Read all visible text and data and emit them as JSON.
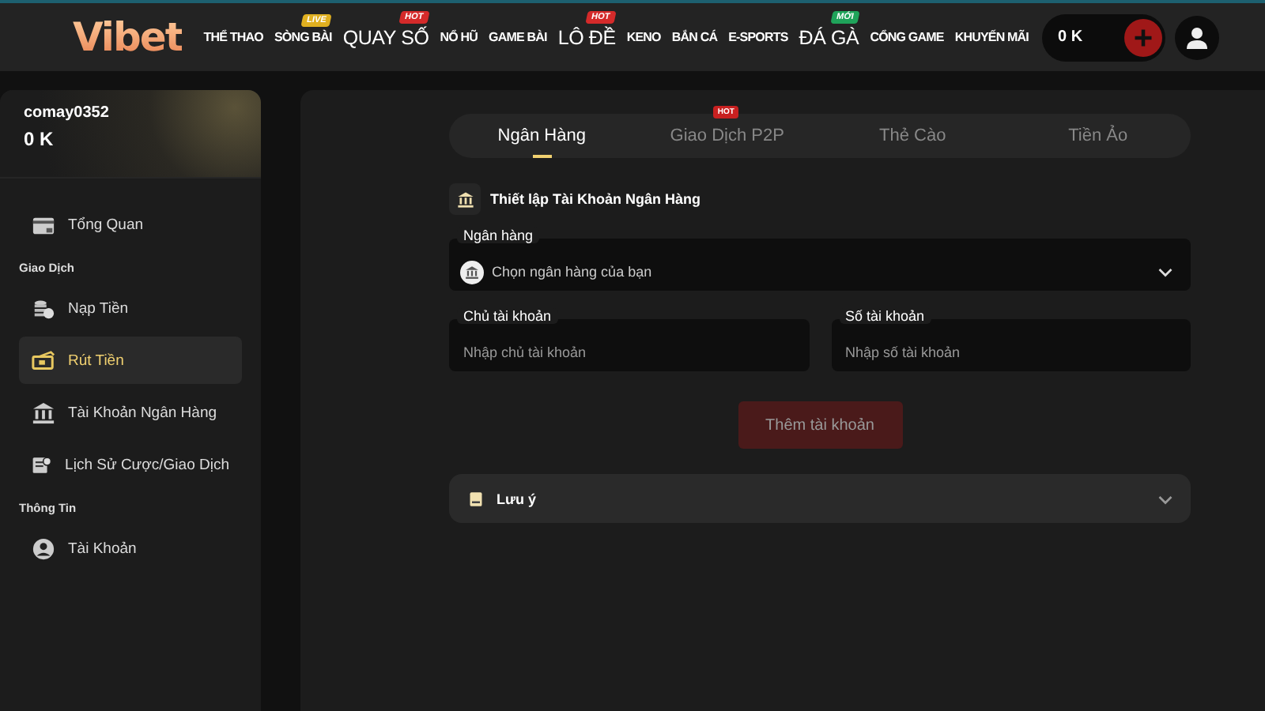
{
  "header": {
    "logo": "Vibet",
    "nav": [
      {
        "label": "THỂ THAO",
        "kind": "small"
      },
      {
        "label": "SÒNG BÀI",
        "kind": "small",
        "badge": "LIVE",
        "color": "#e0b020"
      },
      {
        "label": "QUAY SỐ",
        "kind": "large",
        "badge": "HOT",
        "color": "#d42a2a"
      },
      {
        "label": "NỔ HŨ",
        "kind": "small"
      },
      {
        "label": "GAME BÀI",
        "kind": "small"
      },
      {
        "label": "LÔ ĐỀ",
        "kind": "large",
        "badge": "HOT",
        "color": "#d42a2a"
      },
      {
        "label": "KENO",
        "kind": "small"
      },
      {
        "label": "BẮN CÁ",
        "kind": "small"
      },
      {
        "label": "E-SPORTS",
        "kind": "small"
      },
      {
        "label": "ĐÁ GÀ",
        "kind": "large",
        "badge": "MỚI",
        "color": "#1fa35a"
      },
      {
        "label": "CỔNG GAME",
        "kind": "small"
      },
      {
        "label": "KHUYẾN MÃI",
        "kind": "small"
      }
    ],
    "balance": "0 K"
  },
  "sidebar": {
    "username": "comay0352",
    "balance": "0 K",
    "items": [
      {
        "kind": "item",
        "label": "Tổng Quan",
        "selected": false
      },
      {
        "kind": "heading",
        "label": "Giao Dịch"
      },
      {
        "kind": "item",
        "label": "Nạp Tiền",
        "selected": false
      },
      {
        "kind": "item",
        "label": "Rút Tiền",
        "selected": true
      },
      {
        "kind": "item",
        "label": "Tài Khoản Ngân Hàng",
        "selected": false
      },
      {
        "kind": "item",
        "label": "Lịch Sử Cược/Giao Dịch",
        "selected": false
      },
      {
        "kind": "heading",
        "label": "Thông Tin"
      },
      {
        "kind": "item",
        "label": "Tài Khoản",
        "selected": false
      }
    ]
  },
  "main": {
    "tabs": [
      {
        "label": "Ngân Hàng",
        "selected": true
      },
      {
        "label": "Giao Dịch P2P",
        "selected": false,
        "badge": "HOT"
      },
      {
        "label": "Thẻ Cào",
        "selected": false
      },
      {
        "label": "Tiền Ảo",
        "selected": false
      }
    ],
    "section_title": "Thiết lập Tài Khoản Ngân Hàng",
    "bank_select": {
      "label": "Ngân hàng",
      "placeholder": "Chọn ngân hàng của bạn"
    },
    "fields": [
      {
        "label": "Chủ tài khoản",
        "placeholder": "Nhập chủ tài khoản"
      },
      {
        "label": "Số tài khoản",
        "placeholder": "Nhập số tài khoản"
      }
    ],
    "submit": {
      "label": "Thêm tài khoản",
      "disabled": true
    },
    "note": {
      "label": "Lưu ý",
      "expanded": false
    }
  }
}
